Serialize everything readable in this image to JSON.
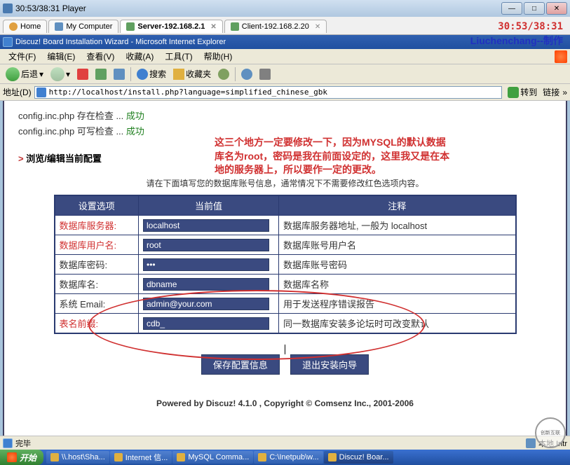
{
  "titlebar": {
    "text": "30:53/38:31 Player"
  },
  "overlay": {
    "time": "30:53/38:31",
    "author": "Liuchenchang--制作"
  },
  "tabs": {
    "home": "Home",
    "comp": "My Computer",
    "server": "Server-192.168.2.1",
    "client": "Client-192.168.2.20"
  },
  "ie_title": "Discuz! Board Installation Wizard - Microsoft Internet Explorer",
  "menu": {
    "file": "文件(F)",
    "edit": "编辑(E)",
    "view": "查看(V)",
    "fav": "收藏(A)",
    "tools": "工具(T)",
    "help": "帮助(H)"
  },
  "toolbar": {
    "back": "后退",
    "search": "搜索",
    "favorites": "收藏夹"
  },
  "address": {
    "label": "地址(D)",
    "url": "http://localhost/install.php?language=simplified_chinese_gbk",
    "go": "转到",
    "links": "链接"
  },
  "checks": {
    "line1_a": "config.inc.php 存在检查 ... ",
    "line1_b": "成功",
    "line2_a": "config.inc.php 可写检查 ... ",
    "line2_b": "成功"
  },
  "section": {
    "gt": ">",
    "title": " 浏览/编辑当前配置"
  },
  "red_note": "这三个地方一定要修改一下，因为MYSQL的默认数据库名为root，密码是我在前面设定的，这里我又是在本地的服务器上，所以要作一定的更改。",
  "instruct": "请在下面填写您的数据库账号信息，通常情况下不需要修改红色选项内容。",
  "table": {
    "headers": {
      "option": "设置选项",
      "value": "当前值",
      "desc": "注释"
    },
    "rows": [
      {
        "label": "数据库服务器:",
        "red": true,
        "value": "localhost",
        "type": "text",
        "desc": "数据库服务器地址, 一般为 localhost"
      },
      {
        "label": "数据库用户名:",
        "red": true,
        "value": "root",
        "type": "text",
        "desc": "数据库账号用户名"
      },
      {
        "label": "数据库密码:",
        "red": false,
        "value": "•••",
        "type": "password",
        "desc": "数据库账号密码"
      },
      {
        "label": "数据库名:",
        "red": false,
        "value": "dbname",
        "type": "text",
        "desc": "数据库名称"
      },
      {
        "label": "系统 Email:",
        "red": false,
        "value": "admin@your.com",
        "type": "text",
        "desc": "用于发送程序错误报告"
      },
      {
        "label": "表名前缀:",
        "red": true,
        "value": "cdb_",
        "type": "text",
        "desc": "同一数据库安装多论坛时可改变默认"
      }
    ]
  },
  "buttons": {
    "save": "保存配置信息",
    "exit": "退出安装向导"
  },
  "footer": "Powered by Discuz! 4.1.0 ,  Copyright © Comsenz Inc., 2001-2006",
  "status": {
    "done": "完毕",
    "zone": "本地 Intr"
  },
  "watermark": "创新互联",
  "taskbar": {
    "start": "开始",
    "items": [
      "\\\\.host\\Sha...",
      "Internet 信...",
      "MySQL Comma...",
      "C:\\Inetpub\\w...",
      "Discuz! Boar..."
    ]
  }
}
